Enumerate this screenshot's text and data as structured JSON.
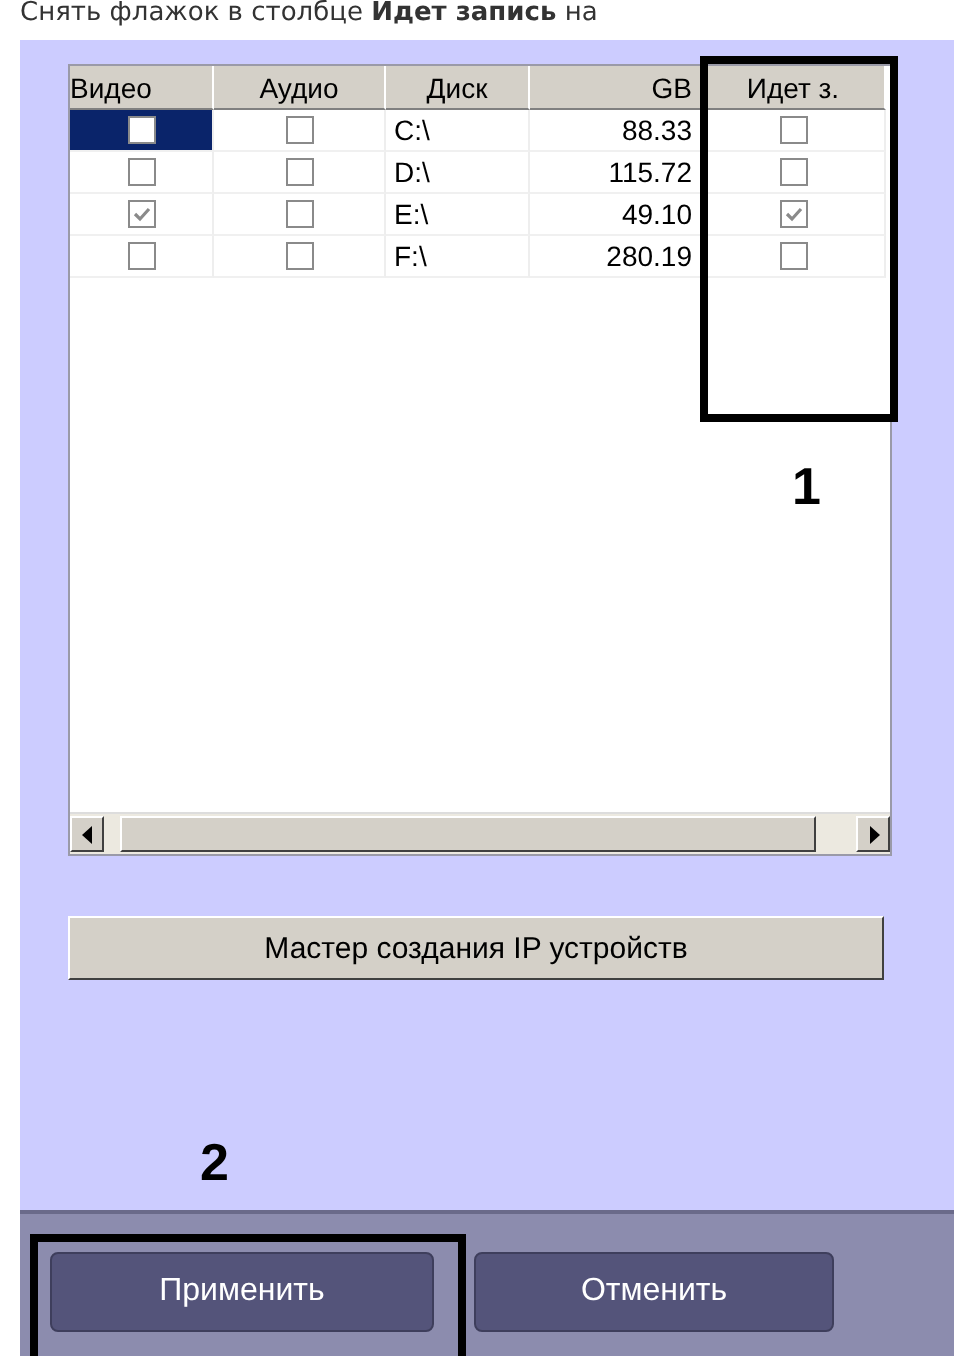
{
  "caption": "Снять флажок в столбце **Идет запись** на",
  "table": {
    "columns": [
      "Видео",
      "Аудио",
      "Диск",
      "GB",
      "Идет з."
    ],
    "rows": [
      {
        "video": false,
        "audio": false,
        "disk": "C:\\",
        "gb": "88.33",
        "recording": false,
        "selected": true
      },
      {
        "video": false,
        "audio": false,
        "disk": "D:\\",
        "gb": "115.72",
        "recording": false,
        "selected": false
      },
      {
        "video": true,
        "audio": false,
        "disk": "E:\\",
        "gb": "49.10",
        "recording": true,
        "selected": false
      },
      {
        "video": false,
        "audio": false,
        "disk": "F:\\",
        "gb": "280.19",
        "recording": false,
        "selected": false
      }
    ]
  },
  "wizard_button": "Мастер создания IP устройств",
  "callouts": [
    "1",
    "2"
  ],
  "buttons": [
    "Применить",
    "Отменить"
  ]
}
